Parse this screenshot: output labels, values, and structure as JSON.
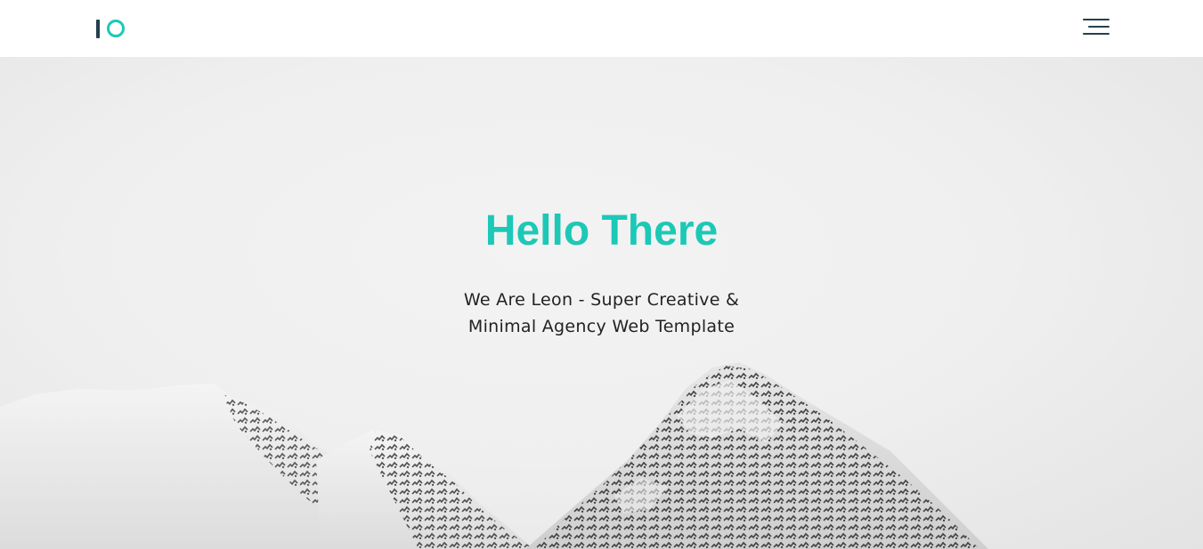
{
  "header": {
    "logo_alt": "logo",
    "menu_icon": "hamburger-menu-icon"
  },
  "hero": {
    "title": "Hello There",
    "subtitle_line1": "We Are Leon - Super Creative &",
    "subtitle_line2": "Minimal Agency Web Template"
  },
  "colors": {
    "accent": "#1cc8b6",
    "dark": "#24404f",
    "text": "#222222",
    "hero_bg": "#efefef"
  }
}
